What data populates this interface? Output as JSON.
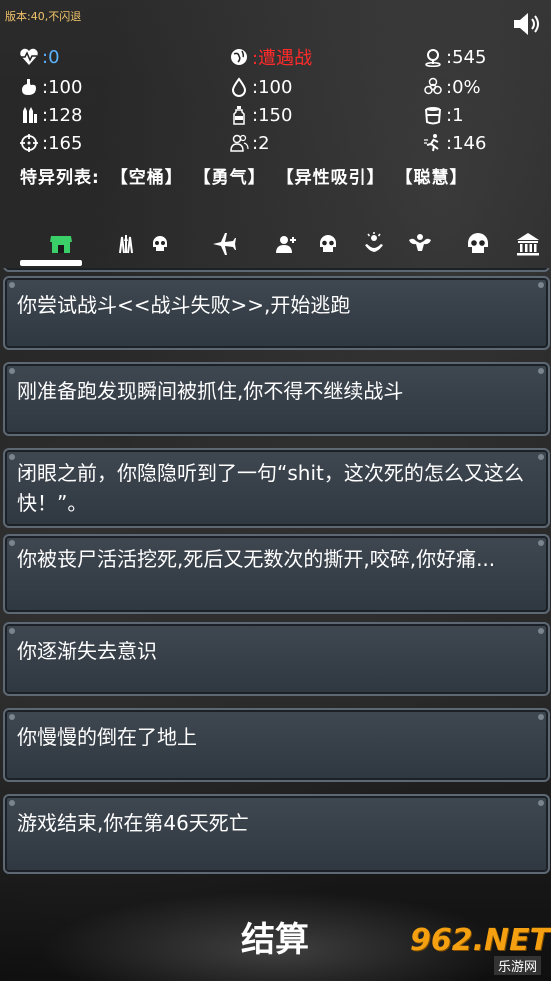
{
  "version_text": "版本:40,不闪退",
  "stats": {
    "health": ":0",
    "encounter": ":遭遇战",
    "location_count": ":545",
    "hunger": ":100",
    "thirst": ":100",
    "infection": ":0%",
    "ammo": ":128",
    "water": ":150",
    "container": ":1",
    "accuracy": ":165",
    "companions": ":2",
    "speed": ":146"
  },
  "traits": {
    "label": "特异列表:",
    "items": [
      "【空桶】",
      "【勇气】",
      "【异性吸引】",
      "【聪慧】"
    ]
  },
  "tabs": [
    {
      "icon": "shop-icon"
    },
    {
      "icon": "weapons-icon"
    },
    {
      "icon": "skull-icon"
    },
    {
      "icon": "airplane-icon"
    },
    {
      "icon": "add-person-icon"
    },
    {
      "icon": "skull-icon"
    },
    {
      "icon": "hands-icon"
    },
    {
      "icon": "muscle-icon"
    },
    {
      "icon": "skull-icon"
    },
    {
      "icon": "bank-icon"
    }
  ],
  "log": [
    "你尝试战斗<<战斗失败>>,开始逃跑",
    "刚准备跑发现瞬间被抓住,你不得不继续战斗",
    "闭眼之前，你隐隐听到了一句“shit，这次死的怎么又这么快！”。",
    "你被丧尸活活挖死,死后又无数次的撕开,咬碎,你好痛...",
    "你逐渐失去意识",
    "你慢慢的倒在了地上",
    "游戏结束,你在第46天死亡"
  ],
  "settle_label": "结算",
  "watermark": {
    "main": "962.NET",
    "sub": "乐游网"
  },
  "colors": {
    "encounter": "#ff2a2a",
    "health": "#5bb4ff",
    "accent": "#f4a010"
  }
}
